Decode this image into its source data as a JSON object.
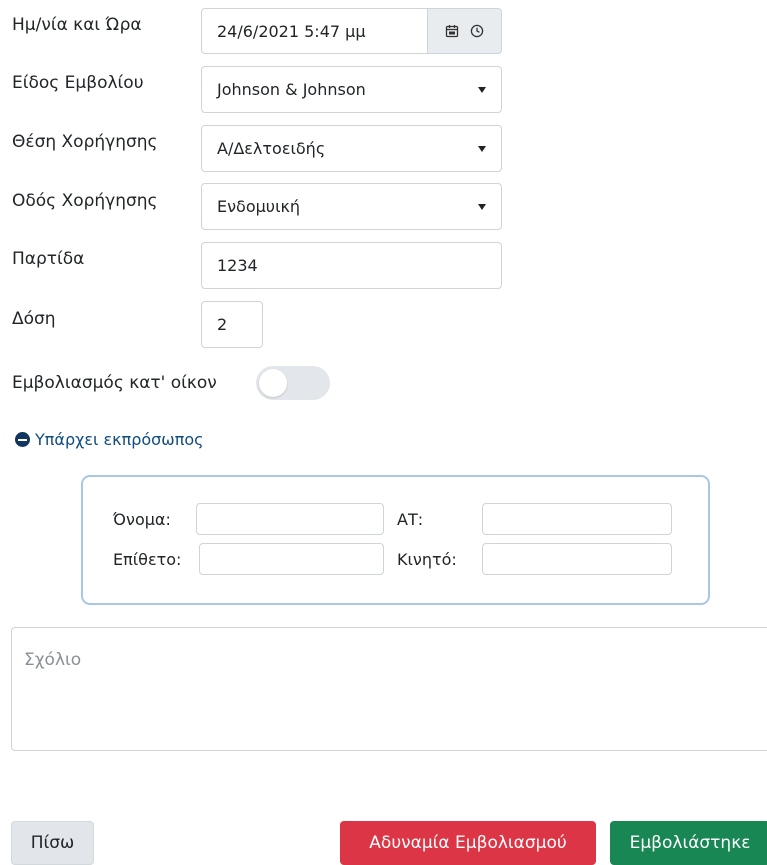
{
  "form": {
    "datetime": {
      "label": "Ημ/νία και Ώρα",
      "value": "24/6/2021 5:47 μμ",
      "icons": [
        "calendar-icon",
        "clock-icon"
      ]
    },
    "vaccine_type": {
      "label": "Είδος Εμβολίου",
      "value": "Johnson & Johnson"
    },
    "administration_site": {
      "label": "Θέση Χορήγησης",
      "value": "Α/Δελτοειδής"
    },
    "administration_route": {
      "label": "Οδός Χορήγησης",
      "value": "Ενδομυική"
    },
    "batch": {
      "label": "Παρτίδα",
      "value": "1234"
    },
    "dose": {
      "label": "Δόση",
      "value": "2"
    },
    "home_vaccination": {
      "label": "Εμβολιασμός κατ' οίκον",
      "on": false
    },
    "representative": {
      "toggle_label": "Υπάρχει εκπρόσωπος",
      "first_name_label": "Όνομα:",
      "last_name_label": "Επίθετο:",
      "id_label": "ΑΤ:",
      "mobile_label": "Κινητό:",
      "first_name_value": "",
      "last_name_value": "",
      "id_value": "",
      "mobile_value": ""
    },
    "comment": {
      "placeholder": "Σχόλιο",
      "value": ""
    }
  },
  "buttons": {
    "back": "Πίσω",
    "unable": "Αδυναμία Εμβολιασμού",
    "vaccinated": "Εμβολιάστηκε"
  },
  "colors": {
    "danger": "#dc3545",
    "success": "#198754",
    "link": "#0f4c81",
    "panel_border": "#a8c7e4"
  }
}
